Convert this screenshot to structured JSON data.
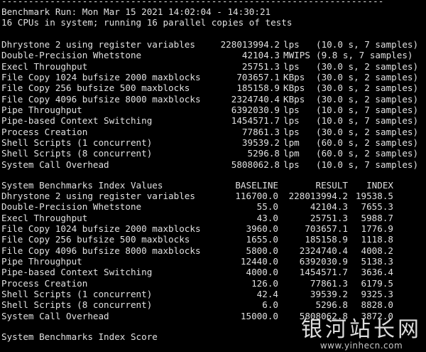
{
  "separator": "------------------------------------------------------------------------",
  "run_header": "Benchmark Run: Mon Mar 15 2021 14:02:04 - 14:30:21",
  "cpu_header": "16 CPUs in system; running 16 parallel copies of tests",
  "results": [
    {
      "name": "Dhrystone 2 using register variables",
      "value": "228013994.2",
      "unit": "lps",
      "detail": "(10.0 s, 7 samples)"
    },
    {
      "name": "Double-Precision Whetstone",
      "value": "42104.3",
      "unit": "MWIPS",
      "detail": "(9.8 s, 7 samples)"
    },
    {
      "name": "Execl Throughput",
      "value": "25751.3",
      "unit": "lps",
      "detail": "(30.0 s, 2 samples)"
    },
    {
      "name": "File Copy 1024 bufsize 2000 maxblocks",
      "value": "703657.1",
      "unit": "KBps",
      "detail": "(30.0 s, 2 samples)"
    },
    {
      "name": "File Copy 256 bufsize 500 maxblocks",
      "value": "185158.9",
      "unit": "KBps",
      "detail": "(30.0 s, 2 samples)"
    },
    {
      "name": "File Copy 4096 bufsize 8000 maxblocks",
      "value": "2324740.4",
      "unit": "KBps",
      "detail": "(30.0 s, 2 samples)"
    },
    {
      "name": "Pipe Throughput",
      "value": "6392030.9",
      "unit": "lps",
      "detail": "(10.0 s, 7 samples)"
    },
    {
      "name": "Pipe-based Context Switching",
      "value": "1454571.7",
      "unit": "lps",
      "detail": "(10.0 s, 7 samples)"
    },
    {
      "name": "Process Creation",
      "value": "77861.3",
      "unit": "lps",
      "detail": "(30.0 s, 2 samples)"
    },
    {
      "name": "Shell Scripts (1 concurrent)",
      "value": "39539.2",
      "unit": "lpm",
      "detail": "(60.0 s, 2 samples)"
    },
    {
      "name": "Shell Scripts (8 concurrent)",
      "value": "5296.8",
      "unit": "lpm",
      "detail": "(60.0 s, 2 samples)"
    },
    {
      "name": "System Call Overhead",
      "value": "5808062.8",
      "unit": "lps",
      "detail": "(10.0 s, 7 samples)"
    }
  ],
  "index_header": {
    "title": "System Benchmarks Index Values",
    "baseline": "BASELINE",
    "result": "RESULT",
    "index": "INDEX"
  },
  "index_rows": [
    {
      "name": "Dhrystone 2 using register variables",
      "baseline": "116700.0",
      "result": "228013994.2",
      "index": "19538.5"
    },
    {
      "name": "Double-Precision Whetstone",
      "baseline": "55.0",
      "result": "42104.3",
      "index": "7655.3"
    },
    {
      "name": "Execl Throughput",
      "baseline": "43.0",
      "result": "25751.3",
      "index": "5988.7"
    },
    {
      "name": "File Copy 1024 bufsize 2000 maxblocks",
      "baseline": "3960.0",
      "result": "703657.1",
      "index": "1776.9"
    },
    {
      "name": "File Copy 256 bufsize 500 maxblocks",
      "baseline": "1655.0",
      "result": "185158.9",
      "index": "1118.8"
    },
    {
      "name": "File Copy 4096 bufsize 8000 maxblocks",
      "baseline": "5800.0",
      "result": "2324740.4",
      "index": "4008.2"
    },
    {
      "name": "Pipe Throughput",
      "baseline": "12440.0",
      "result": "6392030.9",
      "index": "5138.3"
    },
    {
      "name": "Pipe-based Context Switching",
      "baseline": "4000.0",
      "result": "1454571.7",
      "index": "3636.4"
    },
    {
      "name": "Process Creation",
      "baseline": "126.0",
      "result": "77861.3",
      "index": "6179.5"
    },
    {
      "name": "Shell Scripts (1 concurrent)",
      "baseline": "42.4",
      "result": "39539.2",
      "index": "9325.3"
    },
    {
      "name": "Shell Scripts (8 concurrent)",
      "baseline": "6.0",
      "result": "5296.8",
      "index": "8828.0"
    },
    {
      "name": "System Call Overhead",
      "baseline": "15000.0",
      "result": "5808062.8",
      "index": "3872.0"
    }
  ],
  "score_label": "System Benchmarks Index Score",
  "watermark": {
    "text": "银河站长网",
    "url": "www.yinhecn.com"
  }
}
